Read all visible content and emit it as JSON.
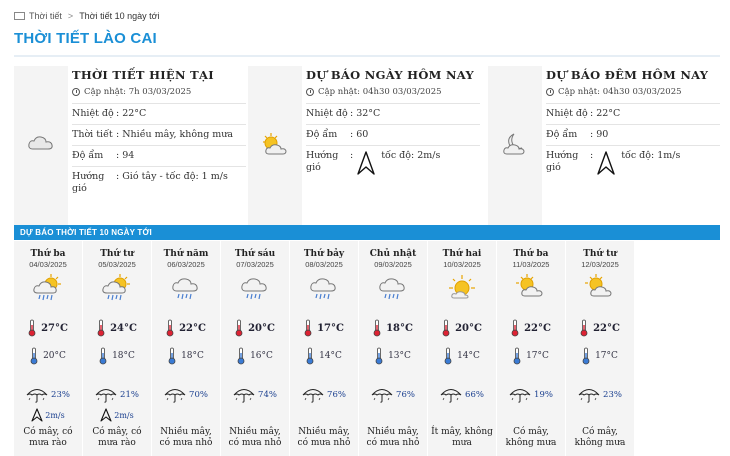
{
  "breadcrumb": {
    "home": "Thời tiết",
    "current": "Thời tiết 10 ngày tới"
  },
  "page_title": "THỜI TIẾT LÀO CAI",
  "panels": [
    {
      "title": "THỜI TIẾT HIỆN TẠI",
      "updated": "Cập nhật: 7h 03/03/2025",
      "icon": "cloud-icon",
      "rows": [
        {
          "label": "Nhiệt độ",
          "value": ": 22°C"
        },
        {
          "label": "Thời tiết",
          "value": ": Nhiều mây, không mưa"
        },
        {
          "label": "Độ ẩm",
          "value": ": 94"
        },
        {
          "label": "Hướng gió",
          "value": ": Gió tây - tốc độ: 1 m/s"
        }
      ]
    },
    {
      "title": "DỰ BÁO NGÀY HÔM NAY",
      "updated": "Cập nhật: 04h30 03/03/2025",
      "icon": "sun-cloud-icon",
      "rows": [
        {
          "label": "Nhiệt độ",
          "value": ": 32°C"
        },
        {
          "label": "Độ ẩm",
          "value": ": 60"
        },
        {
          "label": "Hướng gió",
          "value": ":",
          "wind": "tốc độ: 2m/s"
        }
      ]
    },
    {
      "title": "DỰ BÁO ĐÊM HÔM NAY",
      "updated": "Cập nhật: 04h30 03/03/2025",
      "icon": "moon-cloud-icon",
      "rows": [
        {
          "label": "Nhiệt độ",
          "value": ": 22°C"
        },
        {
          "label": "Độ ẩm",
          "value": ": 90"
        },
        {
          "label": "Hướng gió",
          "value": ":",
          "wind": "tốc độ: 1m/s"
        }
      ]
    }
  ],
  "forecast_title": "DỰ BÁO THỜI TIẾT 10 NGÀY TỚI",
  "days": [
    {
      "name": "Thứ ba",
      "date": "04/03/2025",
      "icon": "sun-rain-icon",
      "hi": "27°C",
      "lo": "20°C",
      "rain": "23%",
      "wind": "2m/s",
      "desc": "Có mây, có mưa rào"
    },
    {
      "name": "Thứ tư",
      "date": "05/03/2025",
      "icon": "sun-rain-icon",
      "hi": "24°C",
      "lo": "18°C",
      "rain": "21%",
      "wind": "2m/s",
      "desc": "Có mây, có mưa rào"
    },
    {
      "name": "Thứ năm",
      "date": "06/03/2025",
      "icon": "rain-cloud-icon",
      "hi": "22°C",
      "lo": "18°C",
      "rain": "70%",
      "wind": "",
      "desc": "Nhiều mây, có mưa nhỏ"
    },
    {
      "name": "Thứ sáu",
      "date": "07/03/2025",
      "icon": "rain-cloud-icon",
      "hi": "20°C",
      "lo": "16°C",
      "rain": "74%",
      "wind": "",
      "desc": "Nhiều mây, có mưa nhỏ"
    },
    {
      "name": "Thứ bảy",
      "date": "08/03/2025",
      "icon": "rain-cloud-icon",
      "hi": "17°C",
      "lo": "14°C",
      "rain": "76%",
      "wind": "",
      "desc": "Nhiều mây, có mưa nhỏ"
    },
    {
      "name": "Chủ nhật",
      "date": "09/03/2025",
      "icon": "rain-cloud-icon",
      "hi": "18°C",
      "lo": "13°C",
      "rain": "76%",
      "wind": "",
      "desc": "Nhiều mây, có mưa nhỏ"
    },
    {
      "name": "Thứ hai",
      "date": "10/03/2025",
      "icon": "sun-icon",
      "hi": "20°C",
      "lo": "14°C",
      "rain": "66%",
      "wind": "",
      "desc": "Ít mây, không mưa"
    },
    {
      "name": "Thứ ba",
      "date": "11/03/2025",
      "icon": "sun-cloud-icon",
      "hi": "22°C",
      "lo": "17°C",
      "rain": "19%",
      "wind": "",
      "desc": "Có mây, không mưa"
    },
    {
      "name": "Thứ tư",
      "date": "12/03/2025",
      "icon": "sun-cloud-icon",
      "hi": "22°C",
      "lo": "17°C",
      "rain": "23%",
      "wind": "",
      "desc": "Có mây, không mưa"
    }
  ],
  "colors": {
    "accent": "#1a8fd6",
    "panel_bg": "#f4f4f4",
    "text_link": "#1a3f8f"
  }
}
